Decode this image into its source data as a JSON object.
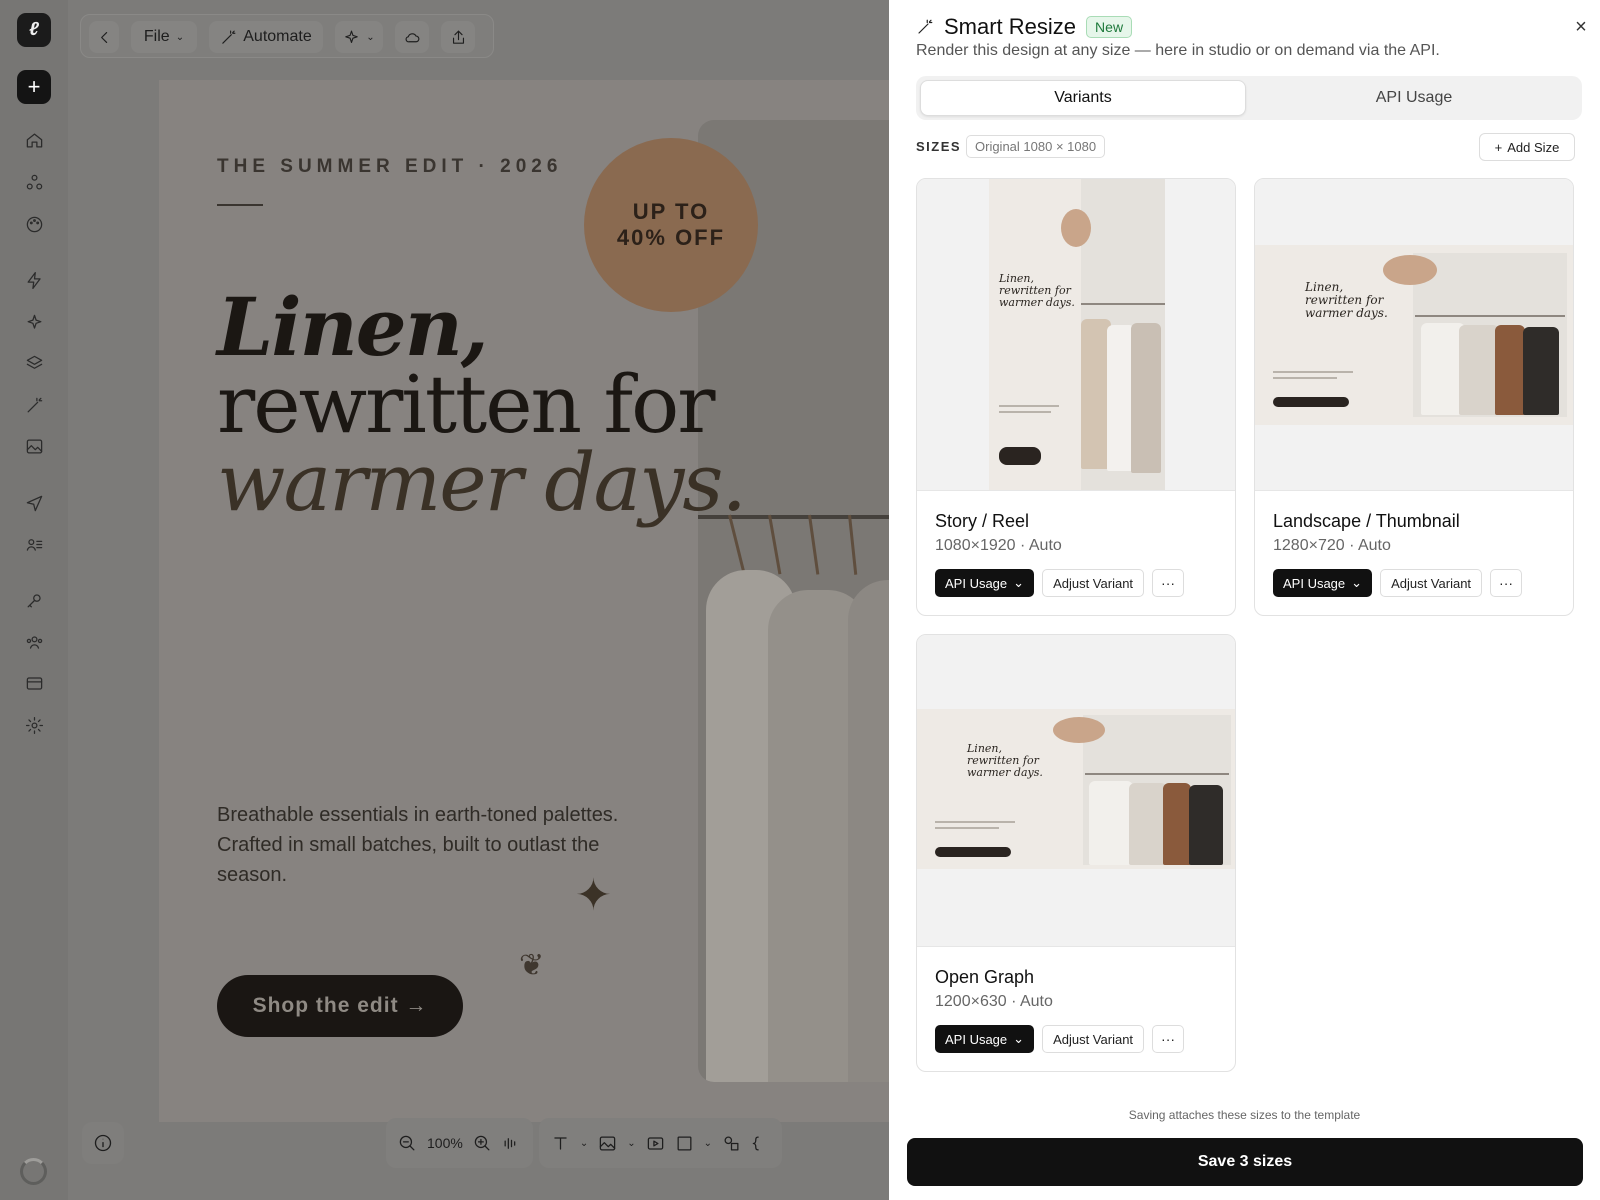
{
  "toolbar": {
    "file_label": "File",
    "automate_label": "Automate"
  },
  "design": {
    "kicker": "THE SUMMER EDIT · 2026",
    "badge_line1": "UP TO",
    "badge_line2": "40% OFF",
    "headline_line1": "Linen,",
    "headline_line2": "rewritten for",
    "headline_line3": "warmer days.",
    "body": "Breathable essentials in earth-toned palettes. Crafted in small batches, built to outlast the season.",
    "cta": "Shop the edit →"
  },
  "bottom_toolbar": {
    "zoom": "100%"
  },
  "drawer": {
    "title": "Smart Resize",
    "new_badge": "New",
    "subtitle": "Render this design at any size — here in studio or on demand via the API.",
    "tabs": [
      {
        "label": "Variants",
        "active": true
      },
      {
        "label": "API Usage",
        "active": false
      }
    ],
    "sizes_label": "SIZES",
    "original_chip": "Original 1080 × 1080",
    "add_size_label": "Add Size",
    "thumb_headline_1": "Linen,",
    "thumb_headline_2": "rewritten for",
    "thumb_headline_3": "warmer days.",
    "cards": [
      {
        "name": "Story / Reel",
        "dims": "1080×1920 · Auto",
        "api_label": "API Usage",
        "adjust_label": "Adjust Variant",
        "more": "···"
      },
      {
        "name": "Landscape / Thumbnail",
        "dims": "1280×720 · Auto",
        "api_label": "API Usage",
        "adjust_label": "Adjust Variant",
        "more": "···"
      },
      {
        "name": "Open Graph",
        "dims": "1200×630 · Auto",
        "api_label": "API Usage",
        "adjust_label": "Adjust Variant",
        "more": "···"
      }
    ],
    "save_note": "Saving attaches these sizes to the template",
    "save_button": "Save 3 sizes",
    "close_glyph": "×"
  },
  "colors": {
    "accent_badge": "#c9a58a",
    "new_badge_text": "#1f7a3c",
    "primary_button": "#111111"
  }
}
